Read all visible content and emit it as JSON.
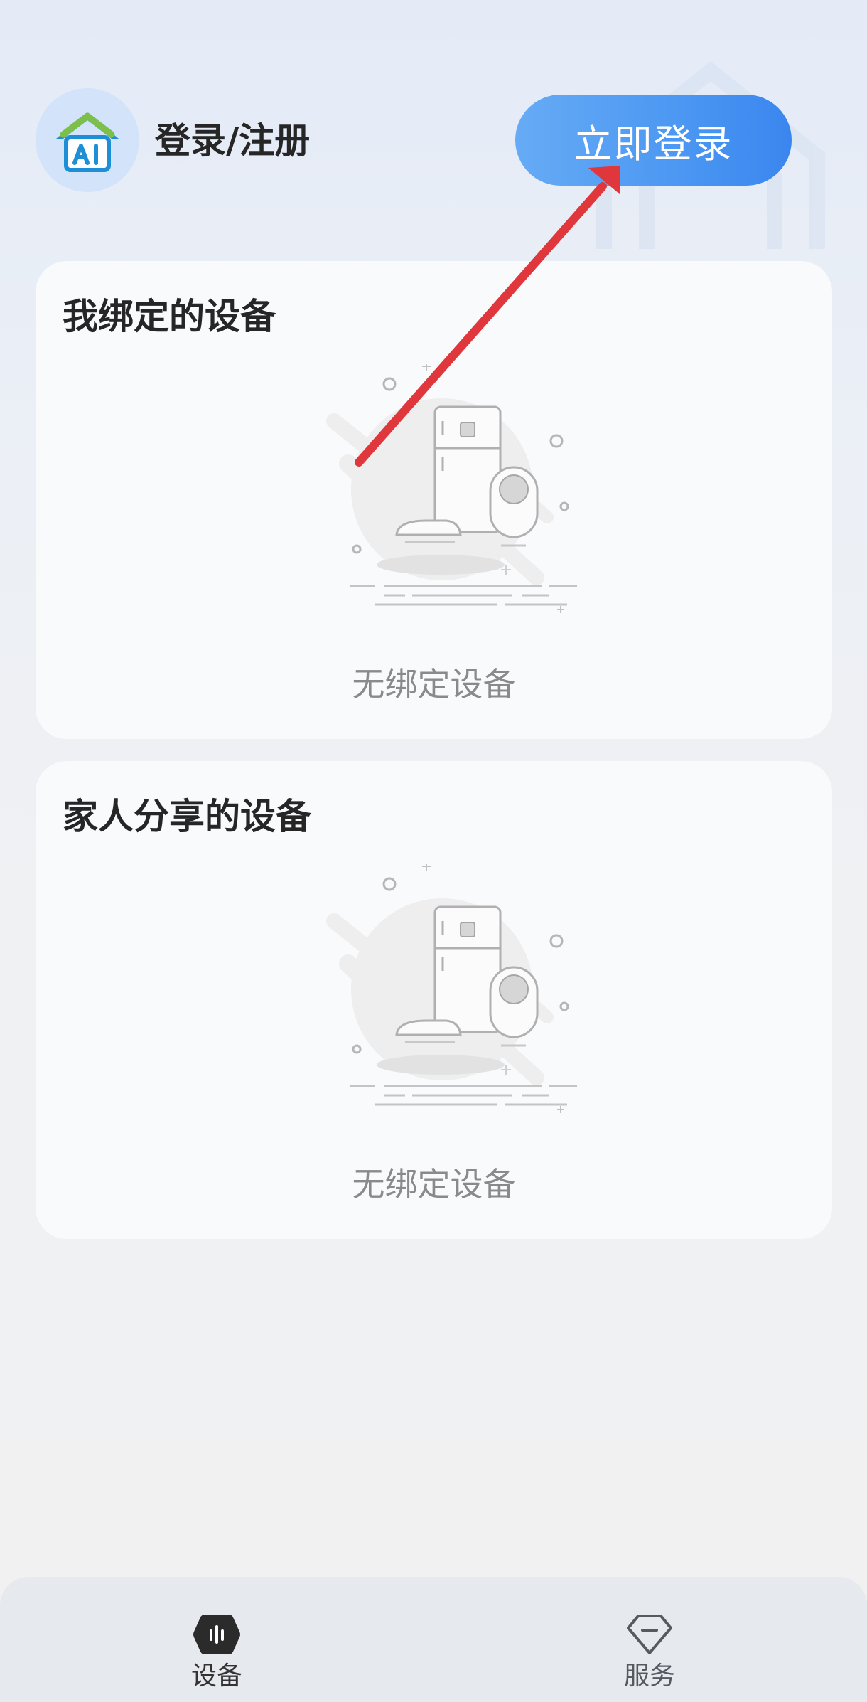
{
  "header": {
    "login_title": "登录/注册",
    "login_button": "立即登录"
  },
  "sections": [
    {
      "title": "我绑定的设备",
      "empty_text": "无绑定设备"
    },
    {
      "title": "家人分享的设备",
      "empty_text": "无绑定设备"
    }
  ],
  "bottom_nav": [
    {
      "label": "设备",
      "icon": "device-hex-icon",
      "active": true
    },
    {
      "label": "服务",
      "icon": "diamond-icon",
      "active": false
    }
  ],
  "annotation": {
    "color": "#e0373c"
  },
  "colors": {
    "accent": "#4b97f2",
    "avatar_bg": "#d2e3fa",
    "logo_green": "#7cc04a",
    "logo_blue": "#1e8fd6"
  }
}
